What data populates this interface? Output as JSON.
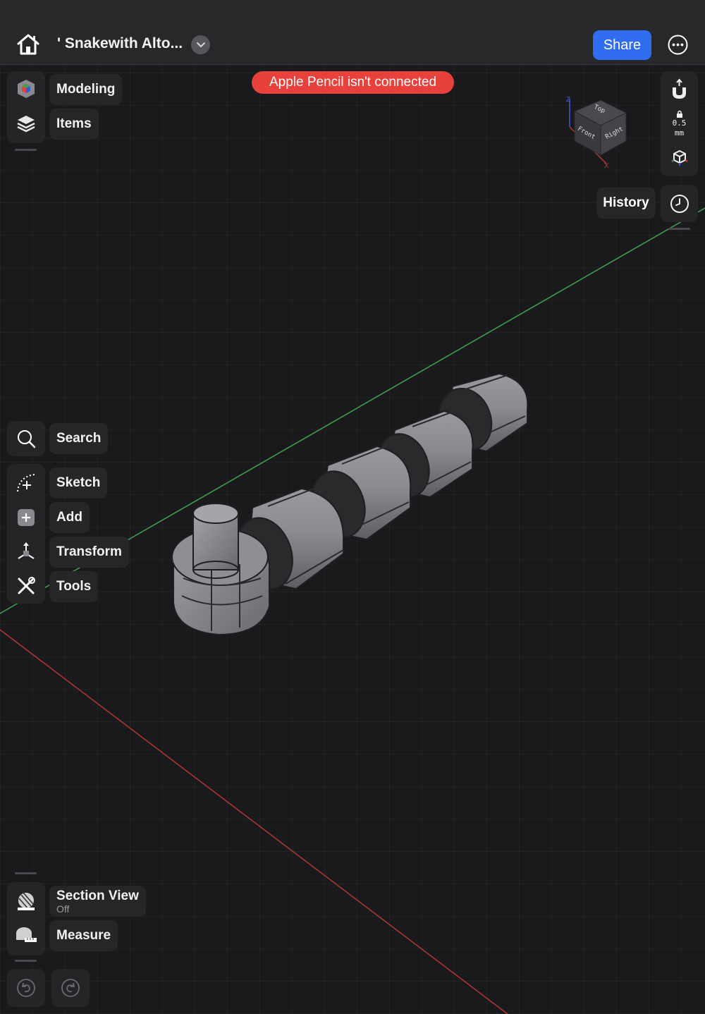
{
  "header": {
    "title": "' Snakewith Alto...",
    "share_label": "Share"
  },
  "banner": {
    "text": "Apple Pencil isn't connected",
    "color": "#e8413b"
  },
  "top_menu": [
    {
      "label": "Modeling",
      "icon": "color-cube-icon"
    },
    {
      "label": "Items",
      "icon": "layers-icon"
    }
  ],
  "tool_menu": {
    "search": "Search",
    "sketch": "Sketch",
    "add": "Add",
    "transform": "Transform",
    "tools": "Tools"
  },
  "bottom_menu": {
    "section_view": "Section View",
    "section_view_state": "Off",
    "measure": "Measure"
  },
  "right_panel": {
    "snap_value": "0.5",
    "snap_unit": "mm",
    "history_label": "History"
  },
  "view_cube": {
    "top": "Top",
    "front": "Front",
    "right": "Right",
    "axis_z": "Z",
    "axis_x": "X"
  },
  "colors": {
    "accent": "#2f6cf0",
    "x_axis": "#c0392b",
    "y_axis": "#3fa34d",
    "z_axis": "#3b5bd6"
  }
}
